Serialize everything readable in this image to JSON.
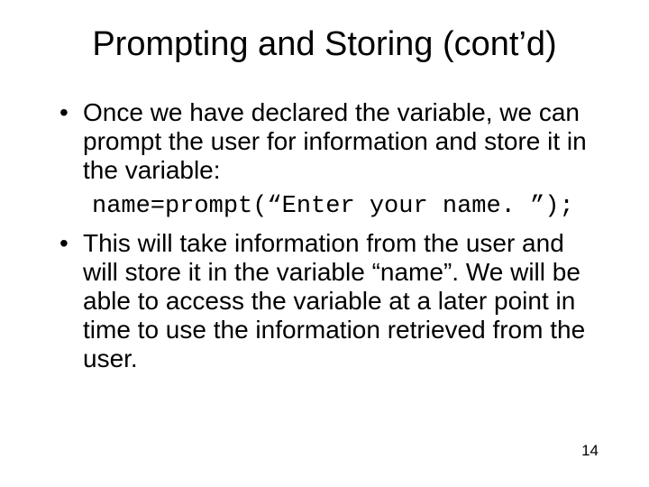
{
  "title": "Prompting and Storing (cont’d)",
  "bullets": {
    "b1": "Once we have declared the variable, we can prompt the user for information and store it in the variable:",
    "code": "name=prompt(“Enter your name. ”);",
    "b2": "This will take information from the user and will store it in the variable “name”. We will be able to access the variable at a later point in time to use the information retrieved from the user."
  },
  "page_number": "14"
}
